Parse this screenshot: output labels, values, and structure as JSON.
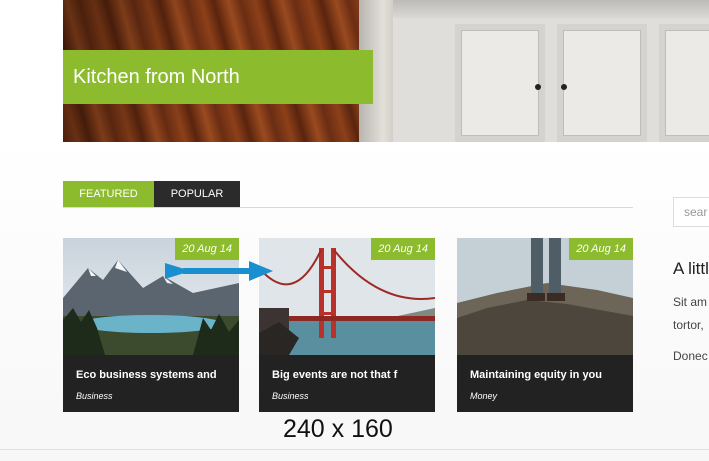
{
  "hero": {
    "title": "Kitchen from North"
  },
  "tabs": {
    "featured": "FEATURED",
    "popular": "POPULAR"
  },
  "cards": [
    {
      "date": "20 Aug 14",
      "title": "Eco business systems and",
      "category": "Business"
    },
    {
      "date": "20 Aug 14",
      "title": "Big events are not that f",
      "category": "Business"
    },
    {
      "date": "20 Aug 14",
      "title": "Maintaining equity in you",
      "category": "Money"
    }
  ],
  "annotation": {
    "caption": "240 x 160",
    "arrow_color": "#1a8fd0"
  },
  "sidebar": {
    "search_placeholder": "sear",
    "heading": "A littl",
    "lines": [
      "Sit am",
      "tortor,",
      "Donec"
    ]
  },
  "colors": {
    "accent": "#8dbb2e",
    "dark": "#2b2b2b"
  }
}
